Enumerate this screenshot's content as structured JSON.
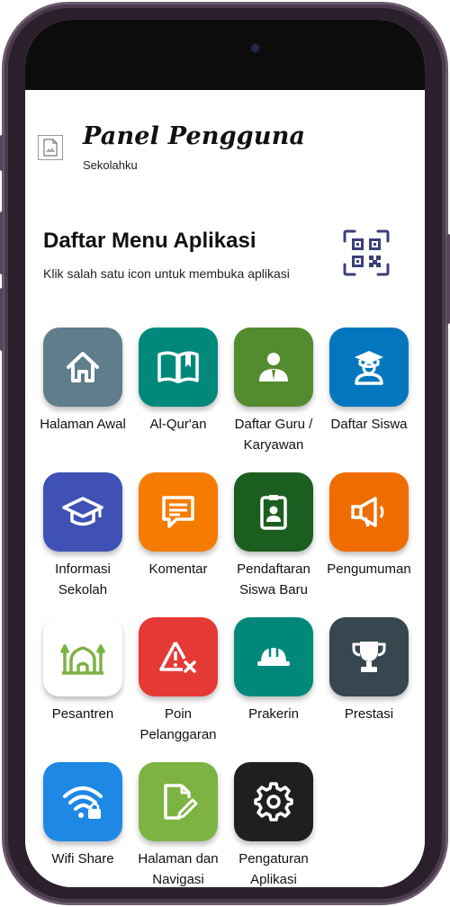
{
  "header": {
    "title": "Panel Pengguna",
    "subtitle": "Sekolahku",
    "logo_icon": "broken-image-icon"
  },
  "menu": {
    "heading": "Daftar Menu Aplikasi",
    "description": "Klik salah satu icon untuk membuka aplikasi",
    "qr_icon": "qr-code-icon",
    "items": [
      {
        "label": "Halaman Awal",
        "icon": "home-icon",
        "color": "#607d8b"
      },
      {
        "label": "Al-Qur'an",
        "icon": "open-book-icon",
        "color": "#00897b"
      },
      {
        "label": "Daftar Guru / Karyawan",
        "icon": "teacher-icon",
        "color": "#558b2f"
      },
      {
        "label": "Daftar Siswa",
        "icon": "student-icon",
        "color": "#0277bd"
      },
      {
        "label": "Informasi Sekolah",
        "icon": "graduation-cap-icon",
        "color": "#3f51b5"
      },
      {
        "label": "Komentar",
        "icon": "comment-icon",
        "color": "#f57c00"
      },
      {
        "label": "Pendaftaran Siswa Baru",
        "icon": "badge-icon",
        "color": "#1b5e20"
      },
      {
        "label": "Pengumuman",
        "icon": "megaphone-icon",
        "color": "#ef6c00"
      },
      {
        "label": "Pesantren",
        "icon": "mosque-icon",
        "color": "#ffffff"
      },
      {
        "label": "Poin Pelanggaran",
        "icon": "warning-x-icon",
        "color": "#e53935"
      },
      {
        "label": "Prakerin",
        "icon": "hard-hat-icon",
        "color": "#00897b"
      },
      {
        "label": "Prestasi",
        "icon": "trophy-icon",
        "color": "#37474f"
      },
      {
        "label": "Wifi Share",
        "icon": "wifi-lock-icon",
        "color": "#1e88e5"
      },
      {
        "label": "Halaman dan Navigasi",
        "icon": "edit-file-icon",
        "color": "#7cb342"
      },
      {
        "label": "Pengaturan Aplikasi",
        "icon": "gear-icon",
        "color": "#1f1f1f"
      }
    ]
  }
}
